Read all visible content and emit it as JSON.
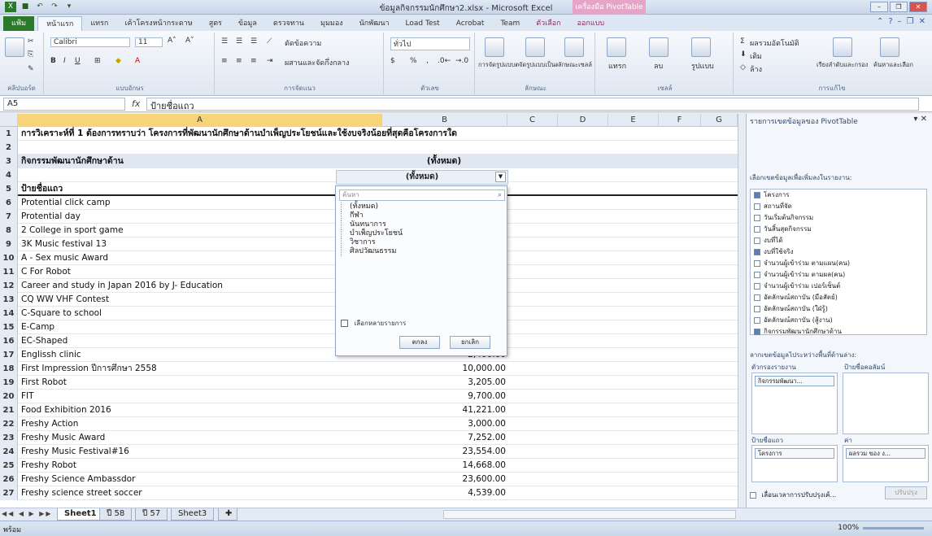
{
  "window": {
    "title": "ข้อมูลกิจกรรมนักศึกษา2.xlsx - Microsoft Excel",
    "context_tab": "เครื่องมือ PivotTable"
  },
  "ribbon": {
    "tabs": [
      "แฟ้ม",
      "หน้าแรก",
      "แทรก",
      "เค้าโครงหน้ากระดาษ",
      "สูตร",
      "ข้อมูล",
      "ตรวจทาน",
      "มุมมอง",
      "นักพัฒนา",
      "Load Test",
      "Acrobat",
      "Team",
      "ตัวเลือก",
      "ออกแบบ"
    ],
    "font_name": "Calibri",
    "font_size": "11",
    "number_format": "ทั่วไป",
    "groups": [
      "คลิปบอร์ด",
      "แบบอักษร",
      "การจัดแนว",
      "ตัวเลข",
      "ลักษณะ",
      "เซลล์",
      "การแก้ไข"
    ],
    "wrap_text": "ตัดข้อความ",
    "merge_center": "ผสานและจัดกึ่งกลาง",
    "cond_format": "การจัดรูปแบบตามเงื่อนไข",
    "format_table": "จัดรูปแบบเป็นตาราง",
    "cell_styles": "ลักษณะเซลล์",
    "insert": "แทรก",
    "delete": "ลบ",
    "format": "รูปแบบ",
    "autosum": "ผลรวมอัตโนมัติ",
    "fill": "เติม",
    "clear": "ล้าง",
    "sort_filter": "เรียงลำดับและกรอง",
    "find_select": "ค้นหาและเลือก"
  },
  "formula_bar": {
    "name_box": "A5",
    "fx": "fx",
    "content": "ป้ายชื่อแถว"
  },
  "sheet": {
    "columns": [
      "A",
      "B",
      "C",
      "D",
      "E",
      "F",
      "G"
    ],
    "rows": [
      {
        "n": "1",
        "a": "การวิเคราะห์ที่ 1 ต้องการทราบว่า  โครงการที่พัฒนานักศึกษาด้านบำเพ็ญประโยชน์และใช้งบจริงน้อยที่สุดคือโครงการใด",
        "b": ""
      },
      {
        "n": "2",
        "a": "",
        "b": ""
      },
      {
        "n": "3",
        "a": "กิจกรรมพัฒนานักศึกษาด้าน",
        "b": "(ทั้งหมด)"
      },
      {
        "n": "4",
        "a": "",
        "b": ""
      },
      {
        "n": "5",
        "a": "ป้ายชื่อแถว",
        "b": ""
      },
      {
        "n": "6",
        "a": "Protential click camp",
        "b": ""
      },
      {
        "n": "7",
        "a": "Protential day",
        "b": ""
      },
      {
        "n": "8",
        "a": "2 College in sport game",
        "b": ""
      },
      {
        "n": "9",
        "a": "3K Music festival 13",
        "b": ""
      },
      {
        "n": "10",
        "a": "A - Sex music Award",
        "b": ""
      },
      {
        "n": "11",
        "a": "C For Robot",
        "b": ""
      },
      {
        "n": "12",
        "a": "Career and study in Japan 2016 by J- Education",
        "b": ""
      },
      {
        "n": "13",
        "a": "CQ WW VHF Contest",
        "b": ""
      },
      {
        "n": "14",
        "a": "C-Square to school",
        "b": ""
      },
      {
        "n": "15",
        "a": "E-Camp",
        "b": ""
      },
      {
        "n": "16",
        "a": "EC-Shaped",
        "b": ""
      },
      {
        "n": "17",
        "a": "Englissh clinic",
        "b": "2,400.00"
      },
      {
        "n": "18",
        "a": "First Impression  ปีการศึกษา  2558",
        "b": "10,000.00"
      },
      {
        "n": "19",
        "a": "First Robot",
        "b": "3,205.00"
      },
      {
        "n": "20",
        "a": "FIT",
        "b": "9,700.00"
      },
      {
        "n": "21",
        "a": "Food Exhibition 2016",
        "b": "41,221.00"
      },
      {
        "n": "22",
        "a": "Freshy Action",
        "b": "3,000.00"
      },
      {
        "n": "23",
        "a": "Freshy Music Award",
        "b": "7,252.00"
      },
      {
        "n": "24",
        "a": "Freshy Music Festival#16",
        "b": "23,554.00"
      },
      {
        "n": "25",
        "a": "Freshy Robot",
        "b": "14,668.00"
      },
      {
        "n": "26",
        "a": "Freshy Science Ambassdor",
        "b": "23,600.00"
      },
      {
        "n": "27",
        "a": "Freshy science street soccer",
        "b": "4,539.00"
      }
    ]
  },
  "filter_popup": {
    "header": "(ทั้งหมด)",
    "search_placeholder": "ค้นหา",
    "items": [
      "(ทั้งหมด)",
      "กีฬา",
      "นันทนาการ",
      "บำเพ็ญประโยชน์",
      "วิชาการ",
      "ศิลปวัฒนธรรม"
    ],
    "multi_label": "เลือกหลายรายการ",
    "ok": "ตกลง",
    "cancel": "ยกเลิก"
  },
  "pivot_pane": {
    "title": "รายการเขตข้อมูลของ PivotTable",
    "choose_label": "เลือกเขตข้อมูลเพื่อเพิ่มลงในรายงาน:",
    "fields": [
      {
        "label": "โครงการ",
        "checked": true
      },
      {
        "label": "สถานที่จัด",
        "checked": false
      },
      {
        "label": "วันเริ่มต้นกิจกรรม",
        "checked": false
      },
      {
        "label": "วันสิ้นสุดกิจกรรม",
        "checked": false
      },
      {
        "label": "งบที่ได้",
        "checked": false
      },
      {
        "label": "งบที่ใช้จริง",
        "checked": true
      },
      {
        "label": "จำนวนผู้เข้าร่วม ตามแผน(คน)",
        "checked": false
      },
      {
        "label": "จำนวนผู้เข้าร่วม ตามผล(คน)",
        "checked": false
      },
      {
        "label": "จำนวนผู้เข้าร่วม เปอร์เซ็นต์",
        "checked": false
      },
      {
        "label": "อัตลักษณ์สถาบัน (มือสัตย์)",
        "checked": false
      },
      {
        "label": "อัตลักษณ์สถาบัน (ใฝ่รู้)",
        "checked": false
      },
      {
        "label": "อัตลักษณ์สถาบัน (สู้งาน)",
        "checked": false
      },
      {
        "label": "กิจกรรมพัฒนานักศึกษาด้าน",
        "checked": true
      }
    ],
    "drag_label": "ลากเขตข้อมูลไประหว่างพื้นที่ด้านล่าง:",
    "report_filter": "ตัวกรองรายงาน",
    "column_labels": "ป้ายชื่อคอลัมน์",
    "row_labels": "ป้ายชื่อแถว",
    "values": "ค่า",
    "filter_chip": "กิจกรรมพัฒนา...",
    "row_chip": "โครงการ",
    "value_chip": "ผลรวม ของ ง...",
    "defer": "เลื่อนเวลาการปรับปรุงเค้...",
    "update": "ปรับปรุง"
  },
  "sheet_tabs": [
    "Sheet1",
    "ปี 58",
    "ปี 57",
    "Sheet3"
  ],
  "status": {
    "ready": "พร้อม",
    "zoom": "100%"
  }
}
